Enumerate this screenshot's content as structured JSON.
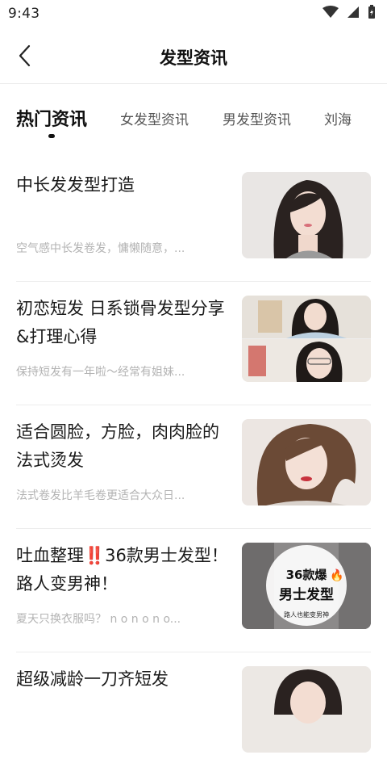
{
  "status_bar": {
    "time": "9:43",
    "wifi_icon": "wifi-icon",
    "signal_icon": "signal-icon",
    "battery_icon": "battery-charging-icon"
  },
  "header": {
    "title": "发型资讯",
    "back_icon": "chevron-left-icon"
  },
  "tabs": [
    {
      "label": "热门资讯",
      "active": true
    },
    {
      "label": "女发型资讯",
      "active": false
    },
    {
      "label": "男发型资讯",
      "active": false
    },
    {
      "label": "刘海",
      "active": false
    }
  ],
  "articles": [
    {
      "title": "中长发发型打造",
      "desc": "空气感中长发卷发，慵懒随意，..."
    },
    {
      "title": "初恋短发 日系锁骨发型分享&打理心得",
      "desc": "保持短发有一年啦～经常有姐妹..."
    },
    {
      "title": "适合圆脸，方脸，肉肉脸的法式烫发",
      "desc": "法式卷发比羊毛卷更适合大众日..."
    },
    {
      "title": "吐血整理‼️36款男士发型！路人变男神！",
      "desc": "夏天只换衣服吗？ n o n o n o...",
      "thumb_text_1": "36款爆",
      "thumb_emoji": "🔥",
      "thumb_text_2": "男士发型",
      "thumb_caption": "路人也能变男神"
    },
    {
      "title": "超级减龄一刀齐短发",
      "desc": ""
    }
  ],
  "colors": {
    "accent": "#111111",
    "muted": "#b3b3b3",
    "divider": "#ededed"
  }
}
